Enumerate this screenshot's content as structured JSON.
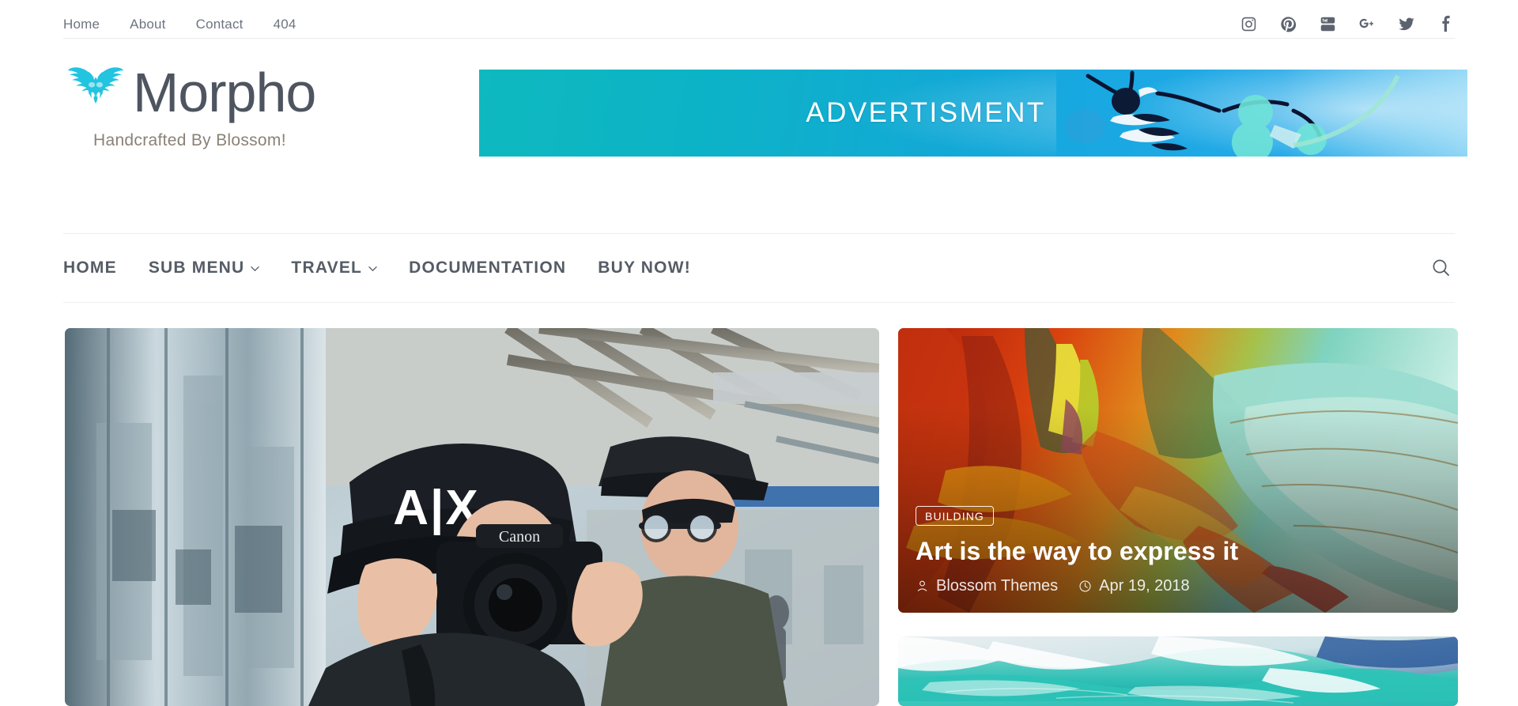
{
  "topbar": {
    "links": [
      {
        "label": "Home"
      },
      {
        "label": "About"
      },
      {
        "label": "Contact"
      },
      {
        "label": "404"
      }
    ],
    "social": [
      {
        "name": "instagram-icon",
        "label": "Instagram"
      },
      {
        "name": "pinterest-icon",
        "label": "Pinterest"
      },
      {
        "name": "youtube-icon",
        "label": "YouTube"
      },
      {
        "name": "google-plus-icon",
        "label": "Google Plus"
      },
      {
        "name": "twitter-icon",
        "label": "Twitter"
      },
      {
        "name": "facebook-icon",
        "label": "Facebook"
      }
    ]
  },
  "brand": {
    "title": "Morpho",
    "tagline": "Handcrafted By Blossom!",
    "logo_icon": "butterfly-icon",
    "logo_color": "#22c4e0",
    "title_color": "#4e5560"
  },
  "advertisement": {
    "label": "ADVERTISMENT",
    "gradient_from": "#0fb9bf",
    "gradient_to": "#2fb5ee",
    "image_subject": "macro photo of a striped insect on blue background"
  },
  "mainnav": {
    "items": [
      {
        "label": "HOME",
        "has_dropdown": false
      },
      {
        "label": "SUB MENU",
        "has_dropdown": true
      },
      {
        "label": "TRAVEL",
        "has_dropdown": true
      },
      {
        "label": "DOCUMENTATION",
        "has_dropdown": false
      },
      {
        "label": "BUY NOW!",
        "has_dropdown": false
      }
    ],
    "search_icon": "search-icon",
    "text_color": "#555c66"
  },
  "content": {
    "hero": {
      "image_subject": "photographer wearing an A|X cap holding a Canon DSLR camera at a train station"
    },
    "cards": [
      {
        "category": "BUILDING",
        "title": "Art is the way to express it",
        "author": "Blossom Themes",
        "date": "Apr 19, 2018",
        "author_icon": "user-icon",
        "date_icon": "clock-icon",
        "image_subject": "abstract painting with red, orange and teal brush strokes"
      },
      {
        "image_subject": "turquoise ocean wave with white sea foam"
      }
    ]
  }
}
